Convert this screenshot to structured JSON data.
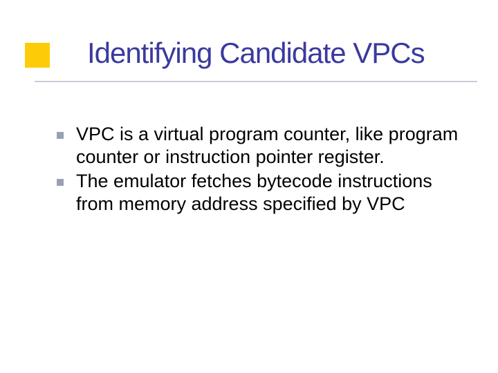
{
  "slide": {
    "title": "Identifying Candidate VPCs",
    "bullets": [
      "VPC is a virtual program counter, like program counter or instruction pointer register.",
      "The emulator fetches bytecode instructions from memory address specified by VPC"
    ]
  }
}
